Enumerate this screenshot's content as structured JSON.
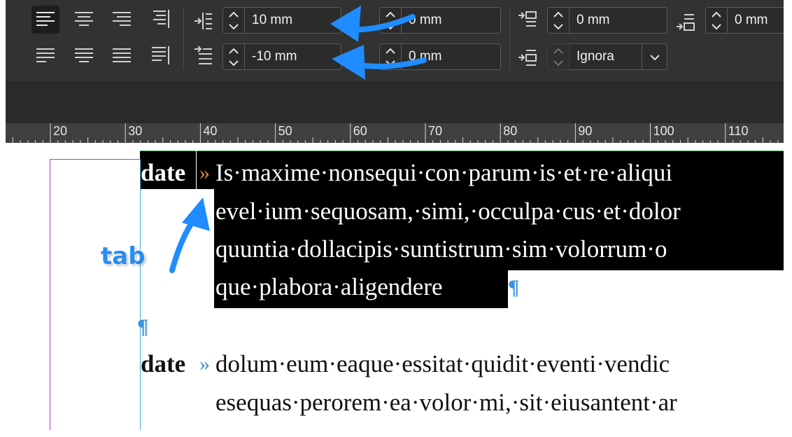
{
  "panel": {
    "indents": {
      "left_indent": "10 mm",
      "first_line_indent": "-10 mm",
      "right_indent": "0 mm",
      "last_line_indent": "0 mm"
    },
    "spacing": {
      "space_before": "0 mm",
      "space_after": "0 mm",
      "align_to_grid": "Ignora"
    }
  },
  "ruler": {
    "labels": [
      "20",
      "30",
      "40",
      "50",
      "60",
      "70",
      "80",
      "90",
      "100",
      "110"
    ]
  },
  "document": {
    "para1": {
      "term": "date",
      "tab_glyph": "»",
      "lines": [
        "Is·maxime·nonsequi·con·parum·is·et·re·aliqui",
        "evel·ium·sequosam,·simi,·occulpa·cus·et·dolor",
        "quuntia·dollacipis·suntistrum·sim·volorrum·o",
        "que·plabora·aligendere"
      ],
      "end_mark": "¶"
    },
    "empty_para_mark": "¶",
    "para2": {
      "term": "date",
      "tab_glyph": "»",
      "lines": [
        "dolum·eum·eaque·essitat·quidit·eventi·vendic",
        "esequas·perorem·ea·volor·mi,·sit·eiusantent·ar"
      ]
    }
  },
  "annotations": {
    "tab_label": "tab",
    "arrow_color": "#1f8cff"
  },
  "colors": {
    "panel_bg": "#323232",
    "ruler_bg": "#404040",
    "margin_guide": "#b03cc0",
    "frame_edge": "#4aa7d8",
    "selection": "#000000",
    "tab_mark_selected": "#d9853b",
    "hidden_char": "#3b95dc"
  }
}
